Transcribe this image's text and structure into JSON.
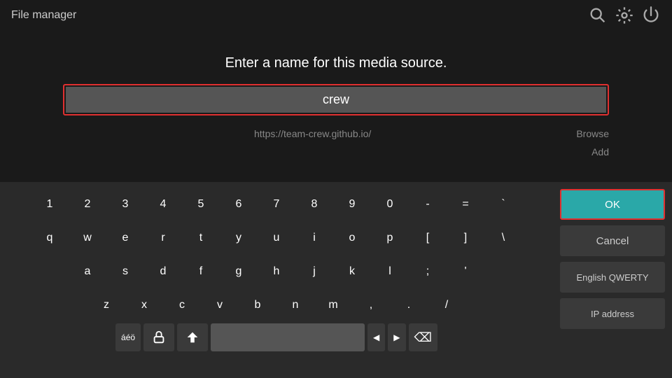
{
  "titlebar": {
    "title": "File manager"
  },
  "dialog": {
    "prompt": "Enter a name for this media source.",
    "input_value": "crew",
    "input_placeholder": "crew",
    "url_text": "https://team-crew.github.io/",
    "browse_label": "Browse",
    "add_label": "Add"
  },
  "keyboard": {
    "rows": [
      [
        "1",
        "2",
        "3",
        "4",
        "5",
        "6",
        "7",
        "8",
        "9",
        "0",
        "-",
        "=",
        "`"
      ],
      [
        "q",
        "w",
        "e",
        "r",
        "t",
        "y",
        "u",
        "i",
        "o",
        "p",
        "[",
        "]",
        "\\"
      ],
      [
        "a",
        "s",
        "d",
        "f",
        "g",
        "h",
        "j",
        "k",
        "l",
        ";",
        "'"
      ],
      [
        "z",
        "x",
        "c",
        "v",
        "b",
        "n",
        "m",
        ",",
        ".",
        "/"
      ]
    ],
    "bottom": {
      "special_label": "áéö",
      "shift_label": "⇧",
      "caps_label": "⬆",
      "space_label": "",
      "left_label": "◀",
      "right_label": "▶",
      "backspace_label": "⌫"
    }
  },
  "actions": {
    "ok_label": "OK",
    "cancel_label": "Cancel",
    "layout_label": "English QWERTY",
    "ip_label": "IP address"
  }
}
